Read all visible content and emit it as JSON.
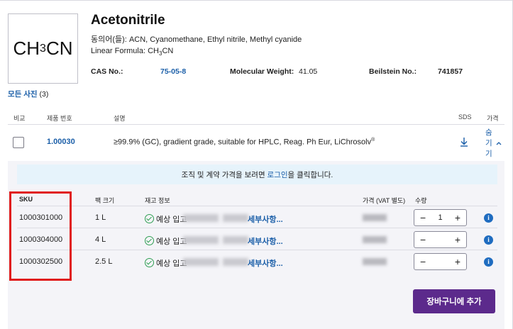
{
  "product": {
    "formula_main": "CH",
    "formula_sub": "3",
    "formula_tail": "CN",
    "title": "Acetonitrile",
    "synonyms_label": "동의어(들):",
    "synonyms": "ACN, Cyanomethane, Ethyl nitrile, Methyl cyanide",
    "linear_label": "Linear Formula:",
    "linear_main": "CH",
    "linear_sub": "3",
    "linear_tail": "CN",
    "cas_label": "CAS No.:",
    "cas_value": "75-05-8",
    "mw_label": "Molecular Weight:",
    "mw_value": "41.05",
    "beilstein_label": "Beilstein No.:",
    "beilstein_value": "741857",
    "photos_link": "모든 사진",
    "photos_count": "(3)"
  },
  "table": {
    "headers": {
      "compare": "비교",
      "number": "제품 번호",
      "desc": "설명",
      "sds": "SDS",
      "price": "가격"
    },
    "row": {
      "number": "1.00030",
      "desc": "≥99.9% (GC), gradient grade, suitable for HPLC, Reag. Ph Eur, LiChrosolv",
      "desc_mark": "®",
      "toggle_l1": "숨",
      "toggle_l2": "기",
      "toggle_l3": "기",
      "toggle_icon": "chevron-up-icon",
      "sds_icon": "download-icon"
    }
  },
  "panel": {
    "banner_prefix": "조직 및 계약 가격을 보려면",
    "banner_link": "로그인",
    "banner_suffix": "을 클릭합니다.",
    "headers": {
      "sku": "SKU",
      "pack": "팩 크기",
      "stock": "재고 정보",
      "price": "가격 (VAT 별도)",
      "qty": "수량"
    },
    "rows": [
      {
        "sku": "1000301000",
        "pack": "1 L",
        "avail": "예상 입고",
        "details": "세부사항...",
        "qty": "1"
      },
      {
        "sku": "1000304000",
        "pack": "4 L",
        "avail": "예상 입고",
        "details": "세부사항...",
        "qty": ""
      },
      {
        "sku": "1000302500",
        "pack": "2.5 L",
        "avail": "예상 입고",
        "details": "세부사항...",
        "qty": ""
      }
    ],
    "minus": "−",
    "plus": "+",
    "info": "i",
    "cart_button": "장바구니에 추가"
  },
  "colors": {
    "accent": "#1a5ea8",
    "cart": "#5c2a8c",
    "highlight": "#e01b1b",
    "banner": "#e6f3fb",
    "ok": "#2e9e52"
  }
}
